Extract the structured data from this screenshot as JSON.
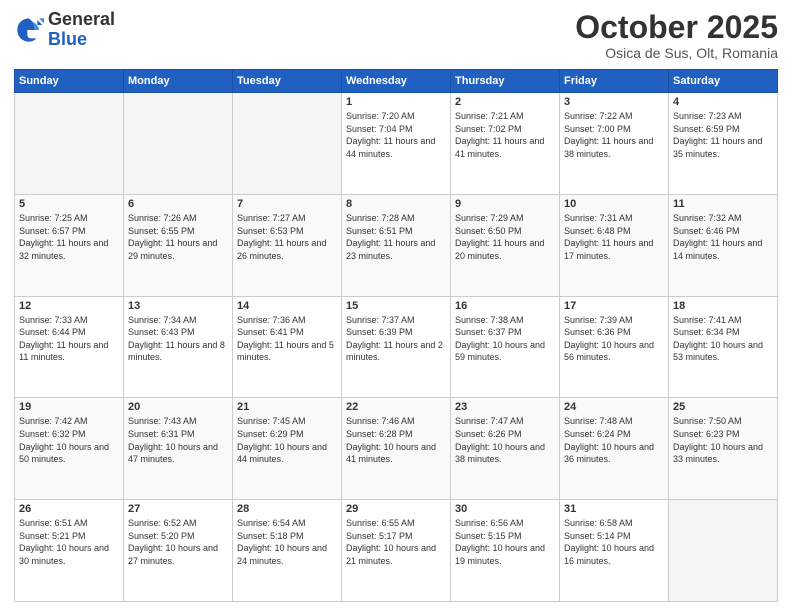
{
  "header": {
    "logo_line1": "General",
    "logo_line2": "Blue",
    "month_title": "October 2025",
    "location": "Osica de Sus, Olt, Romania"
  },
  "weekdays": [
    "Sunday",
    "Monday",
    "Tuesday",
    "Wednesday",
    "Thursday",
    "Friday",
    "Saturday"
  ],
  "weeks": [
    [
      {
        "day": "",
        "sunrise": "",
        "sunset": "",
        "daylight": ""
      },
      {
        "day": "",
        "sunrise": "",
        "sunset": "",
        "daylight": ""
      },
      {
        "day": "",
        "sunrise": "",
        "sunset": "",
        "daylight": ""
      },
      {
        "day": "1",
        "sunrise": "Sunrise: 7:20 AM",
        "sunset": "Sunset: 7:04 PM",
        "daylight": "Daylight: 11 hours and 44 minutes."
      },
      {
        "day": "2",
        "sunrise": "Sunrise: 7:21 AM",
        "sunset": "Sunset: 7:02 PM",
        "daylight": "Daylight: 11 hours and 41 minutes."
      },
      {
        "day": "3",
        "sunrise": "Sunrise: 7:22 AM",
        "sunset": "Sunset: 7:00 PM",
        "daylight": "Daylight: 11 hours and 38 minutes."
      },
      {
        "day": "4",
        "sunrise": "Sunrise: 7:23 AM",
        "sunset": "Sunset: 6:59 PM",
        "daylight": "Daylight: 11 hours and 35 minutes."
      }
    ],
    [
      {
        "day": "5",
        "sunrise": "Sunrise: 7:25 AM",
        "sunset": "Sunset: 6:57 PM",
        "daylight": "Daylight: 11 hours and 32 minutes."
      },
      {
        "day": "6",
        "sunrise": "Sunrise: 7:26 AM",
        "sunset": "Sunset: 6:55 PM",
        "daylight": "Daylight: 11 hours and 29 minutes."
      },
      {
        "day": "7",
        "sunrise": "Sunrise: 7:27 AM",
        "sunset": "Sunset: 6:53 PM",
        "daylight": "Daylight: 11 hours and 26 minutes."
      },
      {
        "day": "8",
        "sunrise": "Sunrise: 7:28 AM",
        "sunset": "Sunset: 6:51 PM",
        "daylight": "Daylight: 11 hours and 23 minutes."
      },
      {
        "day": "9",
        "sunrise": "Sunrise: 7:29 AM",
        "sunset": "Sunset: 6:50 PM",
        "daylight": "Daylight: 11 hours and 20 minutes."
      },
      {
        "day": "10",
        "sunrise": "Sunrise: 7:31 AM",
        "sunset": "Sunset: 6:48 PM",
        "daylight": "Daylight: 11 hours and 17 minutes."
      },
      {
        "day": "11",
        "sunrise": "Sunrise: 7:32 AM",
        "sunset": "Sunset: 6:46 PM",
        "daylight": "Daylight: 11 hours and 14 minutes."
      }
    ],
    [
      {
        "day": "12",
        "sunrise": "Sunrise: 7:33 AM",
        "sunset": "Sunset: 6:44 PM",
        "daylight": "Daylight: 11 hours and 11 minutes."
      },
      {
        "day": "13",
        "sunrise": "Sunrise: 7:34 AM",
        "sunset": "Sunset: 6:43 PM",
        "daylight": "Daylight: 11 hours and 8 minutes."
      },
      {
        "day": "14",
        "sunrise": "Sunrise: 7:36 AM",
        "sunset": "Sunset: 6:41 PM",
        "daylight": "Daylight: 11 hours and 5 minutes."
      },
      {
        "day": "15",
        "sunrise": "Sunrise: 7:37 AM",
        "sunset": "Sunset: 6:39 PM",
        "daylight": "Daylight: 11 hours and 2 minutes."
      },
      {
        "day": "16",
        "sunrise": "Sunrise: 7:38 AM",
        "sunset": "Sunset: 6:37 PM",
        "daylight": "Daylight: 10 hours and 59 minutes."
      },
      {
        "day": "17",
        "sunrise": "Sunrise: 7:39 AM",
        "sunset": "Sunset: 6:36 PM",
        "daylight": "Daylight: 10 hours and 56 minutes."
      },
      {
        "day": "18",
        "sunrise": "Sunrise: 7:41 AM",
        "sunset": "Sunset: 6:34 PM",
        "daylight": "Daylight: 10 hours and 53 minutes."
      }
    ],
    [
      {
        "day": "19",
        "sunrise": "Sunrise: 7:42 AM",
        "sunset": "Sunset: 6:32 PM",
        "daylight": "Daylight: 10 hours and 50 minutes."
      },
      {
        "day": "20",
        "sunrise": "Sunrise: 7:43 AM",
        "sunset": "Sunset: 6:31 PM",
        "daylight": "Daylight: 10 hours and 47 minutes."
      },
      {
        "day": "21",
        "sunrise": "Sunrise: 7:45 AM",
        "sunset": "Sunset: 6:29 PM",
        "daylight": "Daylight: 10 hours and 44 minutes."
      },
      {
        "day": "22",
        "sunrise": "Sunrise: 7:46 AM",
        "sunset": "Sunset: 6:28 PM",
        "daylight": "Daylight: 10 hours and 41 minutes."
      },
      {
        "day": "23",
        "sunrise": "Sunrise: 7:47 AM",
        "sunset": "Sunset: 6:26 PM",
        "daylight": "Daylight: 10 hours and 38 minutes."
      },
      {
        "day": "24",
        "sunrise": "Sunrise: 7:48 AM",
        "sunset": "Sunset: 6:24 PM",
        "daylight": "Daylight: 10 hours and 36 minutes."
      },
      {
        "day": "25",
        "sunrise": "Sunrise: 7:50 AM",
        "sunset": "Sunset: 6:23 PM",
        "daylight": "Daylight: 10 hours and 33 minutes."
      }
    ],
    [
      {
        "day": "26",
        "sunrise": "Sunrise: 6:51 AM",
        "sunset": "Sunset: 5:21 PM",
        "daylight": "Daylight: 10 hours and 30 minutes."
      },
      {
        "day": "27",
        "sunrise": "Sunrise: 6:52 AM",
        "sunset": "Sunset: 5:20 PM",
        "daylight": "Daylight: 10 hours and 27 minutes."
      },
      {
        "day": "28",
        "sunrise": "Sunrise: 6:54 AM",
        "sunset": "Sunset: 5:18 PM",
        "daylight": "Daylight: 10 hours and 24 minutes."
      },
      {
        "day": "29",
        "sunrise": "Sunrise: 6:55 AM",
        "sunset": "Sunset: 5:17 PM",
        "daylight": "Daylight: 10 hours and 21 minutes."
      },
      {
        "day": "30",
        "sunrise": "Sunrise: 6:56 AM",
        "sunset": "Sunset: 5:15 PM",
        "daylight": "Daylight: 10 hours and 19 minutes."
      },
      {
        "day": "31",
        "sunrise": "Sunrise: 6:58 AM",
        "sunset": "Sunset: 5:14 PM",
        "daylight": "Daylight: 10 hours and 16 minutes."
      },
      {
        "day": "",
        "sunrise": "",
        "sunset": "",
        "daylight": ""
      }
    ]
  ]
}
